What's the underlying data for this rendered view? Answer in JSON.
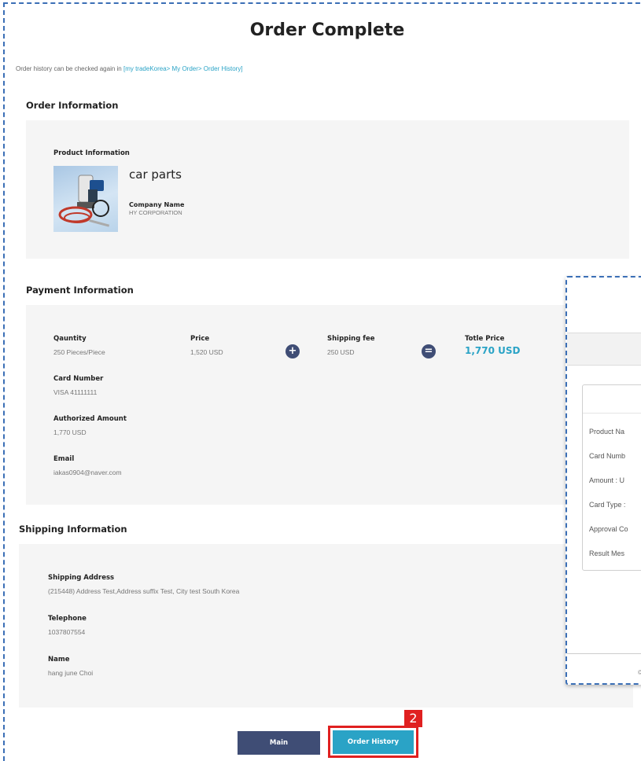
{
  "page": {
    "title": "Order Complete",
    "history_note_prefix": "Order history can be checked again in ",
    "history_note_link": "[my tradeKorea> My Order> Order History]"
  },
  "order_info": {
    "section_title": "Order Information",
    "product_label": "Product Information",
    "product_name": "car parts",
    "company_label": "Company Name",
    "company_value": "HY CORPORATION"
  },
  "payment_info": {
    "section_title": "Payment Information",
    "quantity_label": "Qauntity",
    "quantity_value": "250 Pieces/Piece",
    "price_label": "Price",
    "price_value": "1,520 USD",
    "plus_symbol": "+",
    "shipping_fee_label": "Shipping fee",
    "shipping_fee_value": "250 USD",
    "equals_symbol": "=",
    "total_label": "Totle Price",
    "total_value": "1,770 USD",
    "card_number_label": "Card Number",
    "card_number_value": "VISA 41111111",
    "authorized_label": "Authorized Amount",
    "authorized_value": "1,770 USD",
    "email_label": "Email",
    "email_value": "iakas0904@naver.com"
  },
  "shipping_info": {
    "section_title": "Shipping Information",
    "address_label": "Shipping Address",
    "address_value": "(215448) Address Test,Address suffix Test, City test South Korea",
    "telephone_label": "Telephone",
    "telephone_value": "1037807554",
    "name_label": "Name",
    "name_value": "hang june Choi"
  },
  "popup": {
    "rows": [
      "Product Na",
      "Card Numb",
      "Amount : U",
      "Card Type :",
      "Approval Co",
      "Result Mes"
    ],
    "footer_mark": "©"
  },
  "buttons": {
    "main_label": "Main",
    "order_history_label": "Order History"
  },
  "annotation": {
    "badge_number": "2",
    "highlight_color": "#e02020"
  },
  "colors": {
    "accent": "#2aa3c6",
    "dark_button": "#3f4d75",
    "panel_bg": "#f5f5f5"
  }
}
